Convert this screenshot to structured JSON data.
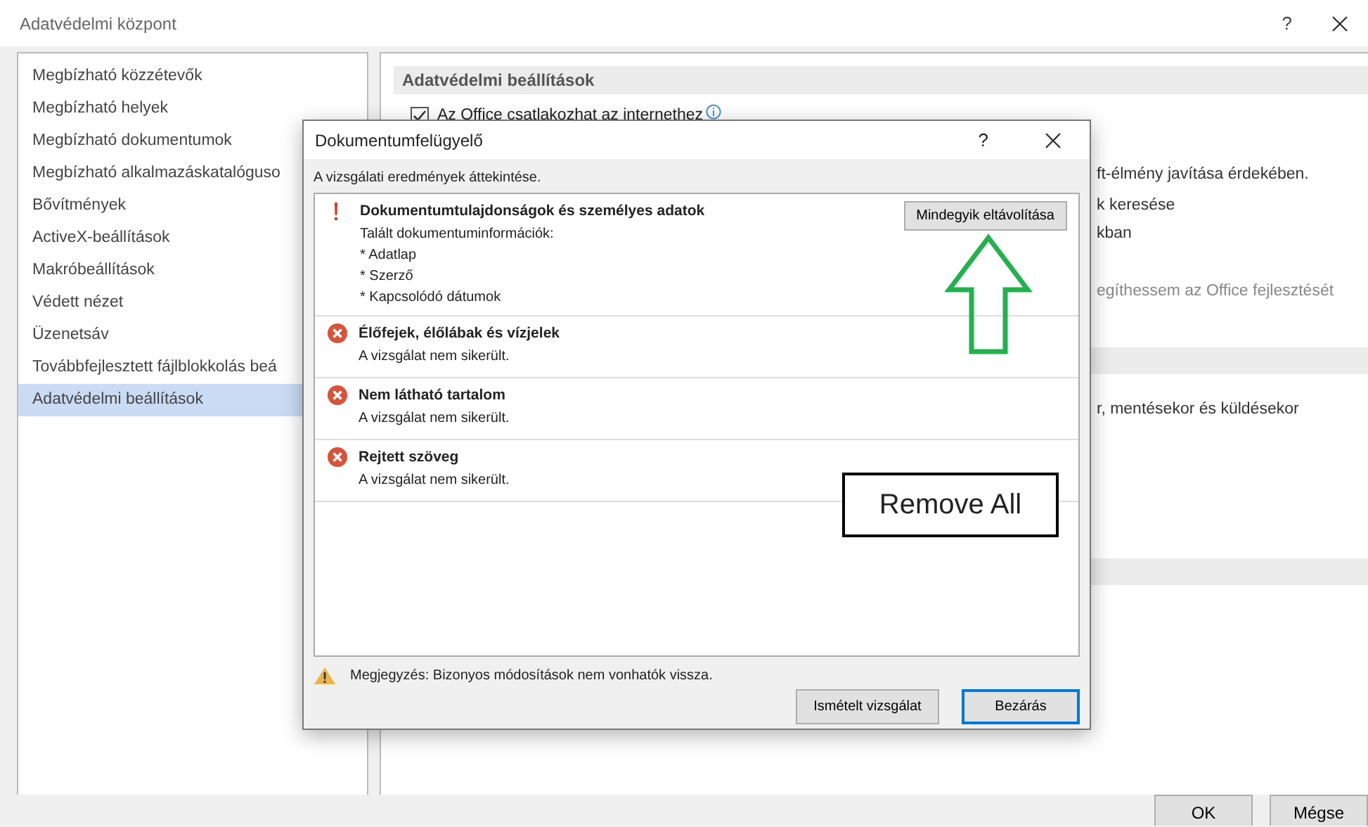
{
  "window": {
    "title": "Adatvédelmi központ",
    "help": "?"
  },
  "sidebar": {
    "items": [
      {
        "label": "Megbízható közzétevők",
        "selected": false
      },
      {
        "label": "Megbízható helyek",
        "selected": false
      },
      {
        "label": "Megbízható dokumentumok",
        "selected": false
      },
      {
        "label": "Megbízható alkalmazáskatalóguso",
        "selected": false
      },
      {
        "label": "Bővítmények",
        "selected": false
      },
      {
        "label": "ActiveX-beállítások",
        "selected": false
      },
      {
        "label": "Makróbeállítások",
        "selected": false
      },
      {
        "label": "Védett nézet",
        "selected": false
      },
      {
        "label": "Üzenetsáv",
        "selected": false
      },
      {
        "label": "Továbbfejlesztett fájlblokkolás beá",
        "selected": false
      },
      {
        "label": "Adatvédelmi beállítások",
        "selected": true
      }
    ]
  },
  "panel": {
    "title": "Adatvédelmi beállítások",
    "lines": [
      {
        "kind": "checkbox",
        "text": "Az Office csatlakozhat az internethez",
        "checked": true
      },
      {
        "kind": "text",
        "text": "ft-élmény javítása érdekében.",
        "disabled": false
      },
      {
        "kind": "text",
        "text": "k keresése",
        "disabled": false
      },
      {
        "kind": "text",
        "text": "kban",
        "disabled": false
      },
      {
        "kind": "text",
        "text": "egíthessem az Office fejlesztését",
        "disabled": true
      },
      {
        "kind": "band"
      },
      {
        "kind": "text",
        "text": "r, mentésekor és küldésekor",
        "disabled": false
      },
      {
        "kind": "band"
      }
    ]
  },
  "footer_buttons": [
    "OK",
    "Mégse"
  ],
  "dialog": {
    "title": "Dokumentumfelügyelő",
    "help": "?",
    "subtitle": "A vizsgálati eredmények áttekintése.",
    "results": [
      {
        "kind": "warning",
        "title": "Dokumentumtulajdonságok és személyes adatok",
        "details": [
          "Talált dokumentuminformációk:",
          "* Adatlap",
          "* Szerző",
          "* Kapcsolódó dátumok"
        ],
        "action": "Mindegyik eltávolítása"
      },
      {
        "kind": "failed",
        "title": "Élőfejek, élőlábak és vízjelek",
        "details": [
          "A vizsgálat nem sikerült."
        ]
      },
      {
        "kind": "failed",
        "title": "Nem látható tartalom",
        "details": [
          "A vizsgálat nem sikerült."
        ]
      },
      {
        "kind": "failed",
        "title": "Rejtett szöveg",
        "details": [
          "A vizsgálat nem sikerült."
        ]
      }
    ],
    "note": "Megjegyzés: Bizonyos módosítások nem vonhatók vissza.",
    "buttons": [
      {
        "label": "Ismételt vizsgálat",
        "default": false
      },
      {
        "label": "Bezárás",
        "default": true
      }
    ]
  },
  "annotation": {
    "label": "Remove All"
  }
}
